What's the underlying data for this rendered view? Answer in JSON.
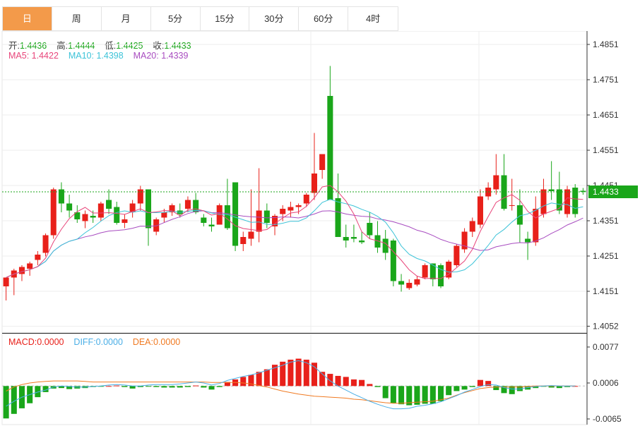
{
  "tabs": [
    "日",
    "周",
    "月",
    "5分",
    "15分",
    "30分",
    "60分",
    "4时"
  ],
  "active_tab": 0,
  "ohlc": {
    "open_label": "开:",
    "open": "1.4436",
    "high_label": "高:",
    "high": "1.4444",
    "low_label": "低:",
    "low": "1.4425",
    "close_label": "收:",
    "close": "1.4433"
  },
  "ma": {
    "ma5_label": "MA5:",
    "ma5": "1.4422",
    "ma10_label": "MA10:",
    "ma10": "1.4398",
    "ma20_label": "MA20:",
    "ma20": "1.4339"
  },
  "macd": {
    "macd_label": "MACD:",
    "macd": "0.0000",
    "diff_label": "DIFF:",
    "diff": "0.0000",
    "dea_label": "DEA:",
    "dea": "0.0000"
  },
  "last_price_tag": "1.4433",
  "colors": {
    "up": "#e8201a",
    "down": "#1aa61a",
    "ma5": "#e8457a",
    "ma10": "#3cc3d8",
    "ma20": "#a84cc0",
    "diff": "#4aaee6",
    "dea": "#f07a22",
    "tab_active": "#f39a4a"
  },
  "chart_data": [
    {
      "type": "candlestick",
      "y_ticks": [
        "1.4851",
        "1.4751",
        "1.4651",
        "1.4551",
        "1.4451",
        "1.4351",
        "1.4251",
        "1.4151",
        "1.4052"
      ],
      "ylim": [
        1.4045,
        1.4875
      ],
      "last": 1.4433,
      "candles": [
        [
          1.4165,
          1.419,
          1.4125,
          1.419
        ],
        [
          1.419,
          1.4215,
          1.414,
          1.421
        ],
        [
          1.42,
          1.4225,
          1.418,
          1.422
        ],
        [
          1.4215,
          1.4235,
          1.4195,
          1.423
        ],
        [
          1.424,
          1.4265,
          1.4225,
          1.4255
        ],
        [
          1.426,
          1.4315,
          1.425,
          1.431
        ],
        [
          1.431,
          1.4445,
          1.43,
          1.444
        ],
        [
          1.444,
          1.446,
          1.4375,
          1.44
        ],
        [
          1.44,
          1.4425,
          1.436,
          1.438
        ],
        [
          1.4375,
          1.4395,
          1.4345,
          1.4355
        ],
        [
          1.435,
          1.438,
          1.433,
          1.437
        ],
        [
          1.4365,
          1.438,
          1.4345,
          1.436
        ],
        [
          1.436,
          1.4405,
          1.435,
          1.44
        ],
        [
          1.441,
          1.444,
          1.437,
          1.4385
        ],
        [
          1.439,
          1.4405,
          1.434,
          1.4345
        ],
        [
          1.4345,
          1.437,
          1.433,
          1.4355
        ],
        [
          1.4375,
          1.441,
          1.436,
          1.44
        ],
        [
          1.44,
          1.445,
          1.438,
          1.444
        ],
        [
          1.444,
          1.444,
          1.428,
          1.433
        ],
        [
          1.432,
          1.436,
          1.431,
          1.4355
        ],
        [
          1.436,
          1.4385,
          1.4345,
          1.4375
        ],
        [
          1.4375,
          1.44,
          1.4365,
          1.4395
        ],
        [
          1.438,
          1.44,
          1.436,
          1.437
        ],
        [
          1.4385,
          1.442,
          1.4375,
          1.441
        ],
        [
          1.441,
          1.443,
          1.437,
          1.4375
        ],
        [
          1.436,
          1.437,
          1.4335,
          1.4345
        ],
        [
          1.434,
          1.436,
          1.432,
          1.4335
        ],
        [
          1.434,
          1.44,
          1.434,
          1.4395
        ],
        [
          1.4395,
          1.447,
          1.4325,
          1.433
        ],
        [
          1.446,
          1.446,
          1.4265,
          1.428
        ],
        [
          1.4285,
          1.432,
          1.4265,
          1.4305
        ],
        [
          1.43,
          1.444,
          1.428,
          1.432
        ],
        [
          1.432,
          1.45,
          1.429,
          1.438
        ],
        [
          1.438,
          1.44,
          1.433,
          1.4345
        ],
        [
          1.4335,
          1.437,
          1.431,
          1.4365
        ],
        [
          1.437,
          1.4395,
          1.435,
          1.4385
        ],
        [
          1.438,
          1.4405,
          1.436,
          1.439
        ],
        [
          1.439,
          1.44,
          1.437,
          1.4395
        ],
        [
          1.44,
          1.443,
          1.439,
          1.4425
        ],
        [
          1.443,
          1.46,
          1.441,
          1.4485
        ],
        [
          1.4495,
          1.454,
          1.447,
          1.454
        ],
        [
          1.4705,
          1.479,
          1.441,
          1.441
        ],
        [
          1.4415,
          1.4485,
          1.431,
          1.4305
        ],
        [
          1.4305,
          1.434,
          1.4275,
          1.4295
        ],
        [
          1.4305,
          1.434,
          1.429,
          1.43
        ],
        [
          1.4295,
          1.432,
          1.4285,
          1.429
        ],
        [
          1.4345,
          1.4375,
          1.43,
          1.431
        ],
        [
          1.431,
          1.435,
          1.426,
          1.4275
        ],
        [
          1.43,
          1.4325,
          1.424,
          1.426
        ],
        [
          1.4295,
          1.43,
          1.4165,
          1.418
        ],
        [
          1.418,
          1.42,
          1.415,
          1.417
        ],
        [
          1.416,
          1.4185,
          1.4155,
          1.4175
        ],
        [
          1.417,
          1.4195,
          1.4165,
          1.4185
        ],
        [
          1.419,
          1.423,
          1.4185,
          1.4225
        ],
        [
          1.423,
          1.423,
          1.4165,
          1.4185
        ],
        [
          1.4225,
          1.423,
          1.416,
          1.4165
        ],
        [
          1.419,
          1.424,
          1.4185,
          1.4235
        ],
        [
          1.4225,
          1.4285,
          1.422,
          1.428
        ],
        [
          1.427,
          1.433,
          1.426,
          1.432
        ],
        [
          1.432,
          1.436,
          1.4305,
          1.435
        ],
        [
          1.434,
          1.444,
          1.433,
          1.442
        ],
        [
          1.442,
          1.446,
          1.441,
          1.4445
        ],
        [
          1.444,
          1.454,
          1.4425,
          1.448
        ],
        [
          1.448,
          1.454,
          1.438,
          1.4385
        ],
        [
          1.4395,
          1.447,
          1.438,
          1.4395
        ],
        [
          1.4395,
          1.444,
          1.429,
          1.434
        ],
        [
          1.43,
          1.432,
          1.424,
          1.429
        ],
        [
          1.429,
          1.442,
          1.428,
          1.4385
        ],
        [
          1.437,
          1.447,
          1.436,
          1.444
        ],
        [
          1.444,
          1.452,
          1.441,
          1.4435
        ],
        [
          1.444,
          1.449,
          1.437,
          1.438
        ],
        [
          1.437,
          1.445,
          1.436,
          1.444
        ],
        [
          1.4445,
          1.4455,
          1.436,
          1.437
        ],
        [
          1.4436,
          1.4444,
          1.4425,
          1.4433
        ]
      ]
    },
    {
      "type": "bar",
      "y_ticks": [
        "0.0077",
        "0.0006",
        "-0.0065"
      ],
      "ylim": [
        -0.0082,
        0.0101
      ],
      "histogram": [
        -0.0064,
        -0.0055,
        -0.0044,
        -0.0034,
        -0.0022,
        -0.0012,
        -0.0005,
        -0.0004,
        -0.0006,
        -0.0005,
        -0.0004,
        -0.0002,
        -0.0001,
        0.0,
        0.0001,
        -0.0002,
        -0.0005,
        -0.0002,
        -0.0001,
        -0.0002,
        -0.0003,
        -0.0003,
        -0.0003,
        -0.0002,
        0.0001,
        -0.0003,
        -0.0007,
        -0.0002,
        0.0008,
        0.0013,
        0.0018,
        0.0022,
        0.0028,
        0.0033,
        0.0042,
        0.0048,
        0.0052,
        0.0054,
        0.0052,
        0.0046,
        0.0028,
        0.0024,
        0.002,
        0.0018,
        0.0013,
        0.0012,
        0.0004,
        -0.0002,
        -0.0024,
        -0.0034,
        -0.0036,
        -0.0038,
        -0.0037,
        -0.0035,
        -0.0035,
        -0.003,
        -0.0018,
        -0.001,
        -0.0007,
        -0.0002,
        0.0012,
        0.001,
        -0.0008,
        -0.0014,
        -0.0016,
        -0.001,
        -0.0007,
        -0.0004,
        -0.0001,
        -0.0003,
        -0.0004,
        -0.0002,
        0.0
      ],
      "diff": [
        -0.004,
        -0.003,
        -0.0022,
        -0.0017,
        -0.0012,
        -0.0008,
        -0.0002,
        0.0,
        -0.0001,
        -0.0002,
        -0.0002,
        -0.0001,
        0.0,
        0.0002,
        0.0003,
        0.0002,
        0.0,
        0.0,
        0.0002,
        0.0003,
        0.0003,
        0.0003,
        0.0004,
        0.0006,
        0.0008,
        0.0006,
        0.0002,
        0.0005,
        0.0011,
        0.0015,
        0.0019,
        0.0022,
        0.0026,
        0.0031,
        0.0036,
        0.0041,
        0.0047,
        0.005,
        0.0046,
        0.0038,
        0.0024,
        0.001,
        0.0,
        -0.0008,
        -0.0016,
        -0.0023,
        -0.003,
        -0.0036,
        -0.0041,
        -0.0045,
        -0.0045,
        -0.0044,
        -0.004,
        -0.0038,
        -0.0035,
        -0.0031,
        -0.0025,
        -0.0019,
        -0.0012,
        -0.0007,
        -0.0001,
        0.0003,
        0.0002,
        -0.0003,
        -0.0006,
        -0.0006,
        -0.0003,
        -0.0001,
        0.0,
        0.0001,
        0.0,
        0.0,
        0.0
      ],
      "dea": [
        -0.001,
        -0.0002,
        0.0003,
        0.0006,
        0.0008,
        0.0009,
        0.001,
        0.001,
        0.001,
        0.001,
        0.0009,
        0.0008,
        0.0008,
        0.0008,
        0.0008,
        0.0008,
        0.0008,
        0.0008,
        0.0008,
        0.0008,
        0.0008,
        0.0008,
        0.0008,
        0.0008,
        0.0008,
        0.0008,
        0.0007,
        0.0007,
        0.0007,
        0.0007,
        0.0006,
        0.0004,
        0.0001,
        -0.0002,
        -0.0006,
        -0.001,
        -0.0013,
        -0.0016,
        -0.0018,
        -0.002,
        -0.0021,
        -0.0022,
        -0.0023,
        -0.0024,
        -0.0026,
        -0.0027,
        -0.0029,
        -0.0031,
        -0.0033,
        -0.0034,
        -0.0034,
        -0.0033,
        -0.0032,
        -0.0031,
        -0.003,
        -0.0027,
        -0.0024,
        -0.0018,
        -0.0013,
        -0.0009,
        -0.0005,
        -0.0003,
        -0.0002,
        -0.0002,
        -0.0002,
        -0.0002,
        -0.0001,
        0.0,
        0.0,
        0.0,
        0.0,
        0.0,
        0.0
      ]
    }
  ]
}
